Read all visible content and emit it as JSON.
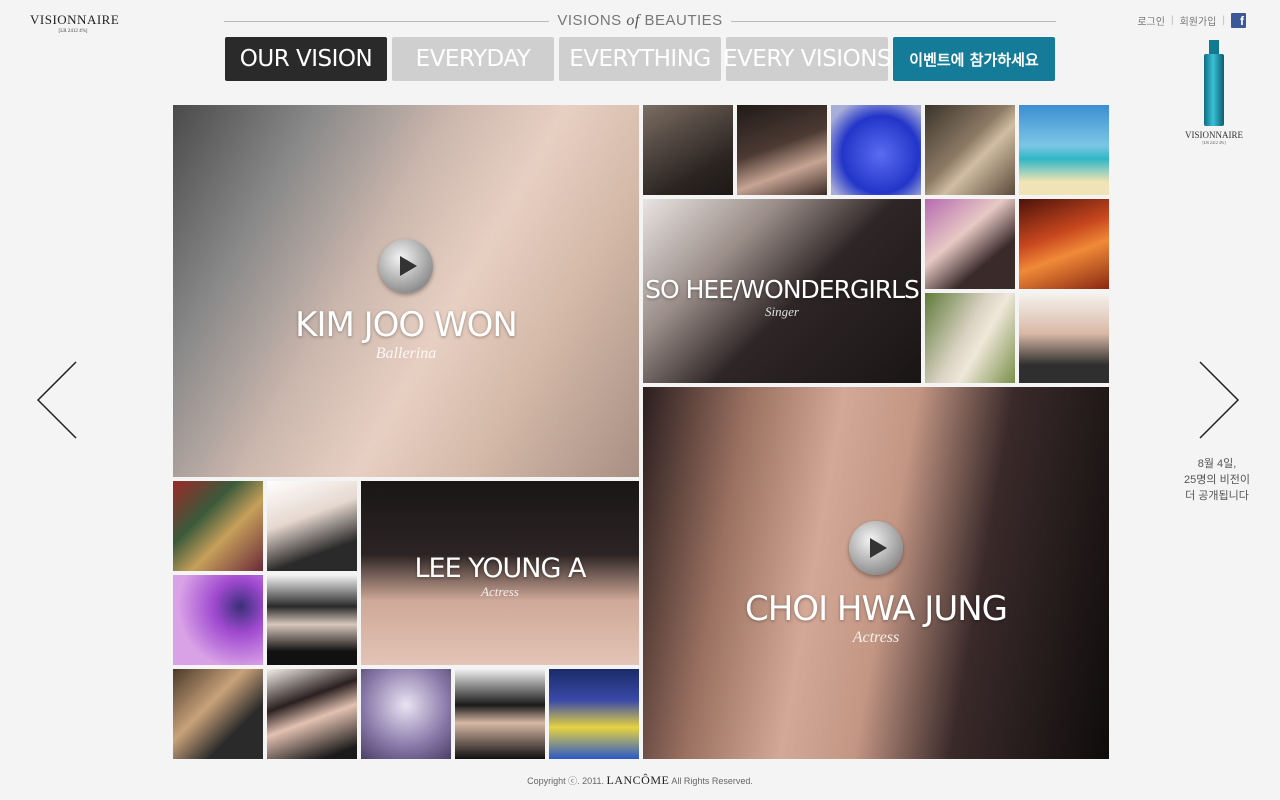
{
  "brand": {
    "logo_name": "VISIONNAIRE",
    "logo_sub": "[LR 2412 4%]"
  },
  "header": {
    "left": "VISIONS",
    "of": "of",
    "right": "BEAUTIES"
  },
  "nav": {
    "tabs": [
      {
        "label": "OUR VISION"
      },
      {
        "label": "EVERYDAY"
      },
      {
        "label": "EVERYTHING"
      },
      {
        "label": "EVERY VISIONS"
      },
      {
        "label": "이벤트에 참가하세요"
      }
    ],
    "active_index": 0
  },
  "top_links": {
    "login": "로그인",
    "sep": "|",
    "signup": "회원가입",
    "facebook": "f"
  },
  "product": {
    "name": "VISIONNAIRE",
    "sub": "[LR 2412 4%]"
  },
  "notice": {
    "line1": "8월 4일,",
    "line2": "25명의 비전이",
    "line3": "더 공개됩니다"
  },
  "features": {
    "kim": {
      "name": "KIM JOO WON",
      "role": "Ballerina"
    },
    "sohee": {
      "name": "SO HEE/WONDERGIRLS",
      "role": "Singer"
    },
    "lee": {
      "name": "LEE YOUNG A",
      "role": "Actress"
    },
    "choi": {
      "name": "CHOI HWA JUNG",
      "role": "Actress"
    }
  },
  "footer": {
    "copyright": "Copyright ⓒ. 2011.",
    "brand": "LANCÔME",
    "rights": "All Rights Reserved."
  },
  "colors": {
    "active_tab": "#2a2a2a",
    "inactive_tab": "#cfcfcf",
    "event_tab": "#147c98",
    "facebook": "#3b5998"
  }
}
